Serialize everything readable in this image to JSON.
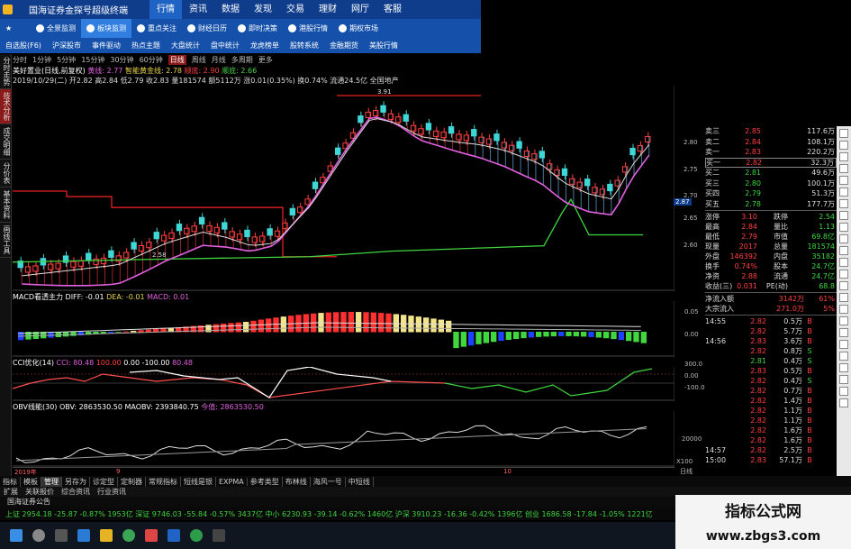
{
  "window": {
    "title": "国海证券金探号超级终端",
    "menu": [
      "行情",
      "资讯",
      "数据",
      "发现",
      "交易",
      "理财",
      "网厅",
      "客服"
    ],
    "active_menu": "行情"
  },
  "toolbar_top": [
    "全景监测",
    "板块监测",
    "重点关注",
    "财经日历",
    "即时决策",
    "港股行情",
    "期权市场"
  ],
  "toolbar_top_selected": "板块监测",
  "toolbar_bottom": [
    "自选股(F6)",
    "沪深股市",
    "事件驱动",
    "热点主题",
    "大盘统计",
    "盘中统计",
    "龙虎榜单",
    "股转系统",
    "金融期货",
    "美股行情"
  ],
  "periods": [
    "分时",
    "1分钟",
    "5分钟",
    "15分钟",
    "30分钟",
    "60分钟",
    "日线",
    "周线",
    "月线",
    "多周期",
    "更多"
  ],
  "period_selected": "日线",
  "left_tabs": [
    "分时走势",
    "技术分析",
    "成交明细",
    "分价表",
    "基本资料",
    "画线工具"
  ],
  "stock_info": {
    "name": "美好置业(日线,前复权)",
    "ind1": "黄线: 2.77",
    "ind2": "智能黄金线: 2.78",
    "ind3": "顺底: 2.90",
    "ind4": "顺底: 2.66",
    "line2": "2019/10/29(二) 开2.82 高2.84 低2.79 收2.83 量181574 额5112万 涨0.01(0.35%) 换0.74% 流通24.5亿 全国地产"
  },
  "price_axis": [
    "2.80",
    "2.75",
    "2.70",
    "2.65",
    "2.60"
  ],
  "current_price_tag": "2.87",
  "price_annotations": {
    "high": "3.91",
    "low": "2.58",
    "mid": "2.58"
  },
  "macd": {
    "label": "MACD看透主力",
    "diff": "DIFF: -0.01",
    "dea": "DEA: -0.01",
    "macd": "MACD: 0.01",
    "axis": [
      "0.05",
      "0.00"
    ]
  },
  "cci": {
    "label": "CCI优化(14)",
    "v1": "CCI: 80.48",
    "v2": "100.00",
    "v3": "0.00",
    "v4": "-100.00",
    "v5": "80.48",
    "axis": [
      "300.0",
      "0.00",
      "-100.0"
    ]
  },
  "obv": {
    "label": "OBV线能(30)",
    "obv": "OBV: 2863530.50",
    "maobv": "MAOBV: 2393840.75",
    "extra": "今值: 2863530.50",
    "axis": [
      "20000",
      "X100"
    ]
  },
  "date_axis": [
    "2019年",
    "9",
    "10"
  ],
  "bottom_tabs": [
    "指标",
    "模板",
    "管理",
    "另存为",
    "诊定型",
    "定制器",
    "常规指标",
    "短线是银",
    "EXPMA",
    "参考类型",
    "布林线",
    "海风一号",
    "中短线"
  ],
  "bottom_tabs_selected": "管理",
  "bottom_tabs2": [
    "扩展",
    "关联报价",
    "综合资讯",
    "行业资讯"
  ],
  "announcement": "国海证券公告",
  "ticker": "上证 2954.18 -25.87 -0.87% 1953亿   深证 9746.03 -55.84 -0.57% 3437亿   中小 6230.93 -39.14 -0.62% 1460亿   沪深 3910.23 -16.36 -0.42% 1396亿   创业 1686.58 -17.84 -1.05% 1221亿",
  "order_book": [
    {
      "label": "卖三",
      "price": "2.85",
      "vol": "117.6万"
    },
    {
      "label": "卖二",
      "price": "2.84",
      "vol": "108.1万"
    },
    {
      "label": "卖一",
      "price": "2.83",
      "vol": "220.2万"
    },
    {
      "label": "买一",
      "price": "2.82",
      "vol": "32.3万"
    },
    {
      "label": "买二",
      "price": "2.81",
      "vol": "49.6万"
    },
    {
      "label": "买三",
      "price": "2.80",
      "vol": "100.1万"
    },
    {
      "label": "买四",
      "price": "2.79",
      "vol": "51.3万"
    },
    {
      "label": "买五",
      "price": "2.78",
      "vol": "177.7万"
    }
  ],
  "stats": [
    {
      "l1": "涨停",
      "v1": "3.10",
      "l2": "跌停",
      "v2": "2.54"
    },
    {
      "l1": "最高",
      "v1": "2.84",
      "l2": "量比",
      "v2": "1.13"
    },
    {
      "l1": "最低",
      "v1": "2.79",
      "l2": "市值",
      "v2": "69.8亿"
    },
    {
      "l1": "现量",
      "v1": "2017",
      "l2": "总量",
      "v2": "181574"
    },
    {
      "l1": "外盘",
      "v1": "146392",
      "l2": "内盘",
      "v2": "35182"
    },
    {
      "l1": "换手",
      "v1": "0.74%",
      "l2": "股本",
      "v2": "24.7亿"
    },
    {
      "l1": "净资",
      "v1": "2.88",
      "l2": "流通",
      "v2": "24.7亿"
    },
    {
      "l1": "收益(三)",
      "v1": "0.031",
      "l2": "PE(动)",
      "v2": "68.8"
    }
  ],
  "flows": [
    {
      "label": "净流入额",
      "value": "3142万",
      "pct": "61%"
    },
    {
      "label": "大宗流入",
      "value": "271.0万",
      "pct": "5%"
    }
  ],
  "ticks": [
    {
      "time": "14:55",
      "price": "2.82",
      "vol": "0.5万",
      "side": "B"
    },
    {
      "time": "",
      "price": "2.82",
      "vol": "5.7万",
      "side": "B"
    },
    {
      "time": "14:56",
      "price": "2.83",
      "vol": "3.6万",
      "side": "B"
    },
    {
      "time": "",
      "price": "2.82",
      "vol": "0.8万",
      "side": "S"
    },
    {
      "time": "",
      "price": "2.81",
      "vol": "0.4万",
      "side": "S"
    },
    {
      "time": "",
      "price": "2.83",
      "vol": "0.5万",
      "side": "B"
    },
    {
      "time": "",
      "price": "2.82",
      "vol": "0.4万",
      "side": "S"
    },
    {
      "time": "",
      "price": "2.82",
      "vol": "0.7万",
      "side": "B"
    },
    {
      "time": "",
      "price": "2.82",
      "vol": "1.4万",
      "side": "B"
    },
    {
      "time": "",
      "price": "2.82",
      "vol": "1.1万",
      "side": "B"
    },
    {
      "time": "",
      "price": "2.82",
      "vol": "1.1万",
      "side": "B"
    },
    {
      "time": "",
      "price": "2.82",
      "vol": "1.6万",
      "side": "B"
    },
    {
      "time": "",
      "price": "2.82",
      "vol": "1.6万",
      "side": "B"
    },
    {
      "time": "14:57",
      "price": "2.82",
      "vol": "2.5万",
      "side": "B"
    },
    {
      "time": "15:00",
      "price": "2.83",
      "vol": "57.1万",
      "side": "B"
    }
  ],
  "daily_label": "日线",
  "watermark": {
    "title": "指标公式网",
    "url": "www.zbgs3.com"
  },
  "colors": {
    "title_bar": "#0f3d8c",
    "toolbar": "#1551ab",
    "up": "#ff3030",
    "down": "#3fd6d6",
    "bg": "#000000"
  }
}
